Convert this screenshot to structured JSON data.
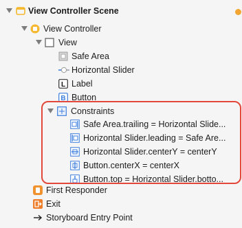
{
  "tree": {
    "scene": "View Controller Scene",
    "view_controller": "View Controller",
    "view": "View",
    "safe_area": "Safe Area",
    "horizontal_slider": "Horizontal Slider",
    "label": "Label",
    "button": "Button",
    "constraints": "Constraints",
    "constraint_items": [
      "Safe Area.trailing = Horizontal Slide...",
      "Horizontal Slider.leading = Safe Are...",
      "Horizontal Slider.centerY = centerY",
      "Button.centerX = centerX",
      "Button.top = Horizontal Slider.botto..."
    ],
    "first_responder": "First Responder",
    "exit": "Exit",
    "storyboard_entry": "Storyboard Entry Point"
  },
  "icons": {
    "label_glyph": "L",
    "button_glyph": "B"
  },
  "colors": {
    "highlight": "#e2473a",
    "scene_yellow": "#f5b830",
    "first_responder_orange": "#f0922e",
    "exit_orange": "#ee7f2d",
    "constraint_blue": "#3b7ddd"
  }
}
